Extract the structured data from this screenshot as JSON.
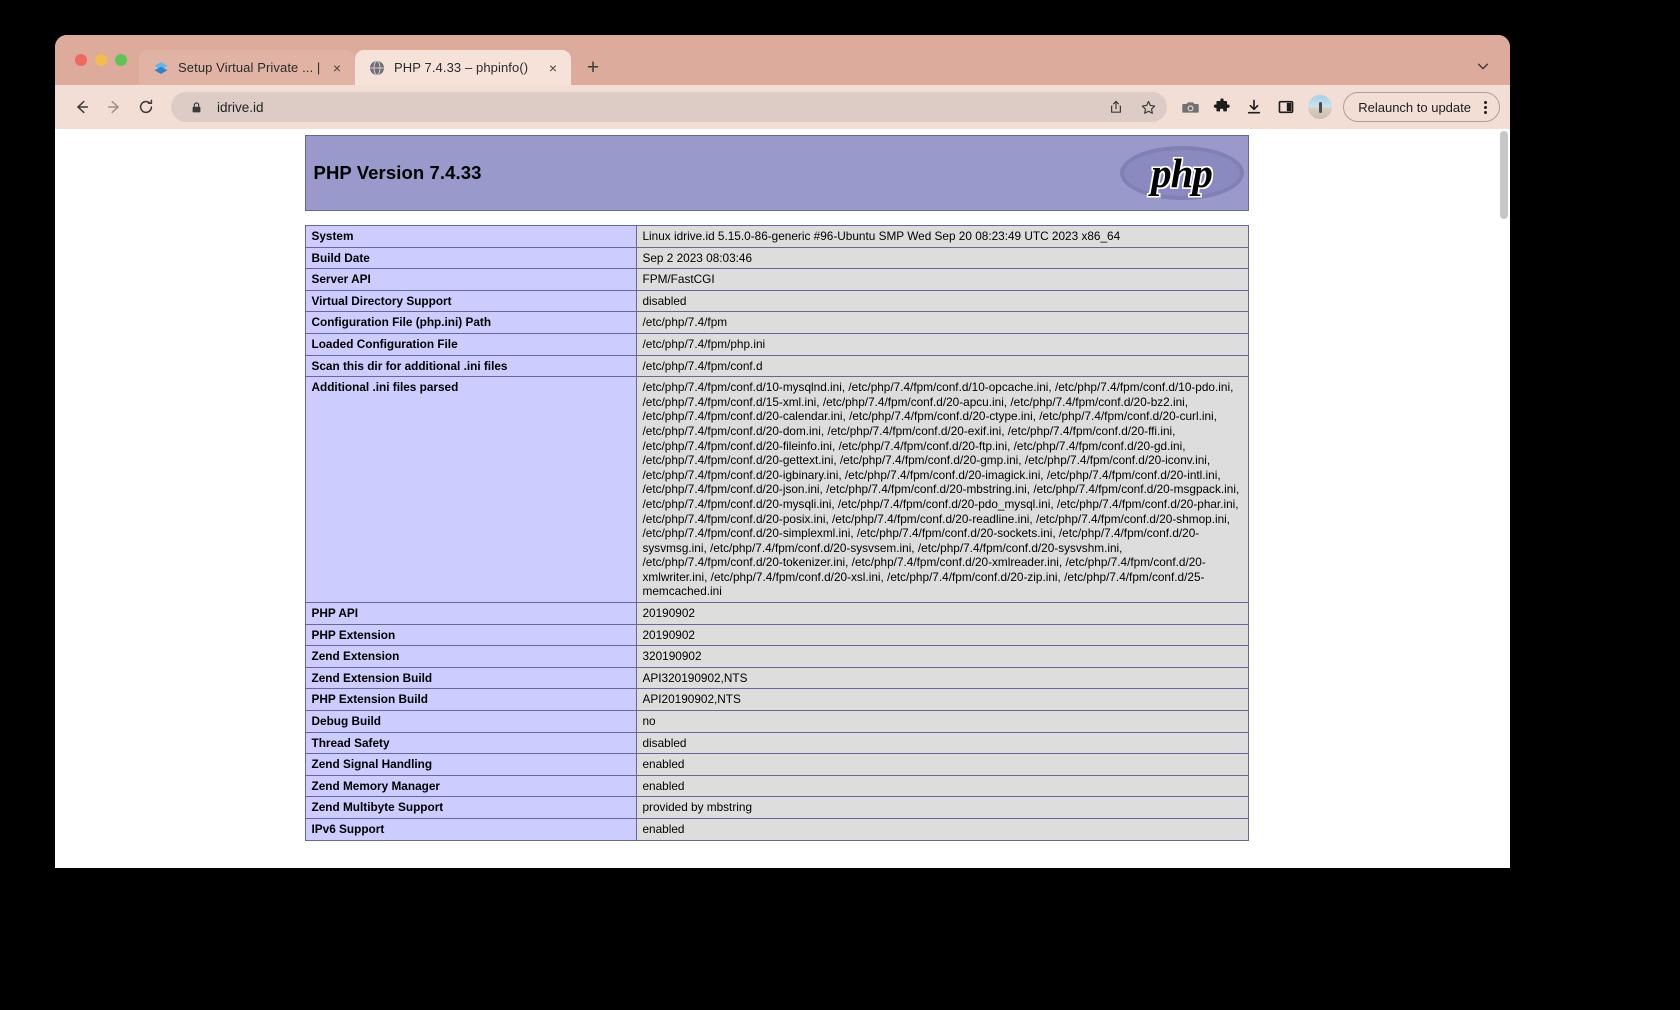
{
  "browser": {
    "tabs": [
      {
        "title": "Setup Virtual Private ... | Book",
        "favicon": "site-favicon",
        "active": false,
        "close_label": "×"
      },
      {
        "title": "PHP 7.4.33 – phpinfo()",
        "favicon": "php-favicon",
        "active": true,
        "close_label": "×"
      }
    ],
    "new_tab_label": "+",
    "tabstrip_chevron_label": "⌄",
    "nav": {
      "back_label": "←",
      "forward_label": "→",
      "reload_label": "⟳"
    },
    "omnibox": {
      "url": "idrive.id",
      "lock_icon": "lock-icon",
      "share_icon": "share-icon",
      "bookmark_icon": "star-icon"
    },
    "toolbar_icons": [
      "camera-icon",
      "extensions-puzzle-icon",
      "downloads-icon",
      "side-panel-icon"
    ],
    "profile_avatar": "profile-avatar",
    "relaunch_label": "Relaunch to update",
    "menu_icon": "kebab-menu-icon"
  },
  "php": {
    "version_title": "PHP Version 7.4.33",
    "logo_text": "php",
    "rows": [
      {
        "key": "System",
        "value": "Linux idrive.id 5.15.0-86-generic #96-Ubuntu SMP Wed Sep 20 08:23:49 UTC 2023 x86_64"
      },
      {
        "key": "Build Date",
        "value": "Sep 2 2023 08:03:46"
      },
      {
        "key": "Server API",
        "value": "FPM/FastCGI"
      },
      {
        "key": "Virtual Directory Support",
        "value": "disabled"
      },
      {
        "key": "Configuration File (php.ini) Path",
        "value": "/etc/php/7.4/fpm"
      },
      {
        "key": "Loaded Configuration File",
        "value": "/etc/php/7.4/fpm/php.ini"
      },
      {
        "key": "Scan this dir for additional .ini files",
        "value": "/etc/php/7.4/fpm/conf.d"
      },
      {
        "key": "Additional .ini files parsed",
        "value": "/etc/php/7.4/fpm/conf.d/10-mysqlnd.ini, /etc/php/7.4/fpm/conf.d/10-opcache.ini, /etc/php/7.4/fpm/conf.d/10-pdo.ini, /etc/php/7.4/fpm/conf.d/15-xml.ini, /etc/php/7.4/fpm/conf.d/20-apcu.ini, /etc/php/7.4/fpm/conf.d/20-bz2.ini, /etc/php/7.4/fpm/conf.d/20-calendar.ini, /etc/php/7.4/fpm/conf.d/20-ctype.ini, /etc/php/7.4/fpm/conf.d/20-curl.ini, /etc/php/7.4/fpm/conf.d/20-dom.ini, /etc/php/7.4/fpm/conf.d/20-exif.ini, /etc/php/7.4/fpm/conf.d/20-ffi.ini, /etc/php/7.4/fpm/conf.d/20-fileinfo.ini, /etc/php/7.4/fpm/conf.d/20-ftp.ini, /etc/php/7.4/fpm/conf.d/20-gd.ini, /etc/php/7.4/fpm/conf.d/20-gettext.ini, /etc/php/7.4/fpm/conf.d/20-gmp.ini, /etc/php/7.4/fpm/conf.d/20-iconv.ini, /etc/php/7.4/fpm/conf.d/20-igbinary.ini, /etc/php/7.4/fpm/conf.d/20-imagick.ini, /etc/php/7.4/fpm/conf.d/20-intl.ini, /etc/php/7.4/fpm/conf.d/20-json.ini, /etc/php/7.4/fpm/conf.d/20-mbstring.ini, /etc/php/7.4/fpm/conf.d/20-msgpack.ini, /etc/php/7.4/fpm/conf.d/20-mysqli.ini, /etc/php/7.4/fpm/conf.d/20-pdo_mysql.ini, /etc/php/7.4/fpm/conf.d/20-phar.ini, /etc/php/7.4/fpm/conf.d/20-posix.ini, /etc/php/7.4/fpm/conf.d/20-readline.ini, /etc/php/7.4/fpm/conf.d/20-shmop.ini, /etc/php/7.4/fpm/conf.d/20-simplexml.ini, /etc/php/7.4/fpm/conf.d/20-sockets.ini, /etc/php/7.4/fpm/conf.d/20-sysvmsg.ini, /etc/php/7.4/fpm/conf.d/20-sysvsem.ini, /etc/php/7.4/fpm/conf.d/20-sysvshm.ini, /etc/php/7.4/fpm/conf.d/20-tokenizer.ini, /etc/php/7.4/fpm/conf.d/20-xmlreader.ini, /etc/php/7.4/fpm/conf.d/20-xmlwriter.ini, /etc/php/7.4/fpm/conf.d/20-xsl.ini, /etc/php/7.4/fpm/conf.d/20-zip.ini, /etc/php/7.4/fpm/conf.d/25-memcached.ini"
      },
      {
        "key": "PHP API",
        "value": "20190902"
      },
      {
        "key": "PHP Extension",
        "value": "20190902"
      },
      {
        "key": "Zend Extension",
        "value": "320190902"
      },
      {
        "key": "Zend Extension Build",
        "value": "API320190902,NTS"
      },
      {
        "key": "PHP Extension Build",
        "value": "API20190902,NTS"
      },
      {
        "key": "Debug Build",
        "value": "no"
      },
      {
        "key": "Thread Safety",
        "value": "disabled"
      },
      {
        "key": "Zend Signal Handling",
        "value": "enabled"
      },
      {
        "key": "Zend Memory Manager",
        "value": "enabled"
      },
      {
        "key": "Zend Multibyte Support",
        "value": "provided by mbstring"
      },
      {
        "key": "IPv6 Support",
        "value": "enabled"
      }
    ]
  },
  "colors": {
    "php_header_bg": "#9999cc",
    "php_key_bg": "#ccccff",
    "php_val_bg": "#dddddd",
    "php_border": "#666699",
    "tabstrip_bg": "#dcab9b",
    "toolbar_bg": "#f3ded6",
    "active_tab_bg": "#f7e2da"
  }
}
